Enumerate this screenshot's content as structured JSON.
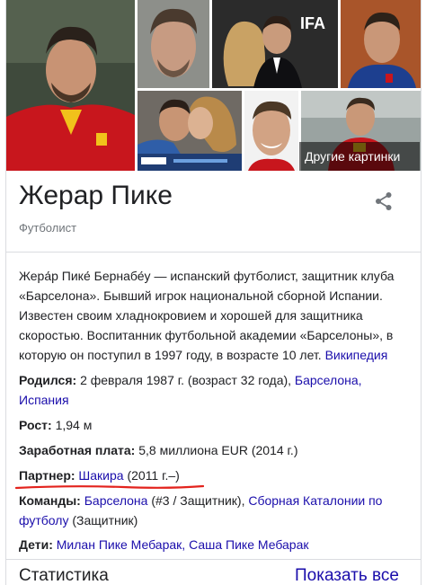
{
  "gallery": {
    "more_images_label": "Другие картинки"
  },
  "header": {
    "title": "Жерар Пике",
    "subtitle": "Футболист",
    "share_icon": "share-icon"
  },
  "description": {
    "text": "Жера́р Пике́ Бернабе́у — испанский футболист, защитник клуба «Барселона». Бывший игрок национальной сборной Испании. Известен своим хладнокровием и хорошей для защитника скоростью. Воспитанник футбольной академии «Барселоны», в которую он поступил в 1997 году, в возрасте 10 лет.",
    "source_link": "Википедия"
  },
  "facts": {
    "born": {
      "label": "Родился:",
      "value": "2 февраля 1987 г. (возраст 32 года),",
      "link1": "Барселона,",
      "link2": "Испания"
    },
    "height": {
      "label": "Рост:",
      "value": "1,94 м"
    },
    "salary": {
      "label": "Заработная плата:",
      "value": "5,8 миллиона EUR (2014 г.)"
    },
    "partner": {
      "label": "Партнер:",
      "link": "Шакира",
      "value": "(2011 г.–)"
    },
    "teams": {
      "label": "Команды:",
      "link1": "Барселона",
      "value1": "(#3 / Защитник),",
      "link2": "Сборная Каталонии по футболу",
      "value2": "(Защитник)"
    },
    "children": {
      "label": "Дети:",
      "link1": "Милан Пике Мебарак,",
      "link2": "Саша Пике Мебарак"
    }
  },
  "footer": {
    "stats_label": "Статистика",
    "show_all_label": "Показать все"
  },
  "colors": {
    "link": "#1a0dab",
    "underline_annotation": "#e3231d"
  }
}
